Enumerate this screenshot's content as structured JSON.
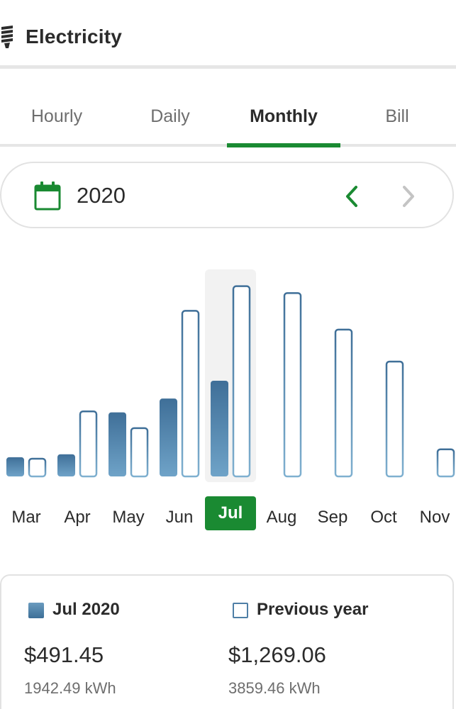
{
  "header": {
    "title": "Electricity",
    "icon": "lightbulb-icon"
  },
  "tabs": [
    {
      "label": "Hourly",
      "active": false
    },
    {
      "label": "Daily",
      "active": false
    },
    {
      "label": "Monthly",
      "active": true
    },
    {
      "label": "Bill",
      "active": false
    }
  ],
  "year_selector": {
    "year": "2020",
    "icon": "calendar-icon",
    "prev_icon": "chevron-left-icon",
    "next_icon": "chevron-right-icon"
  },
  "colors": {
    "accent": "#1a8a32",
    "bar_current": "#4a7aa3",
    "bar_previous_outline": "#4f7fa6",
    "divider": "#e6e6e6"
  },
  "chart_data": {
    "type": "bar",
    "unit": "kWh",
    "categories": [
      "Mar",
      "Apr",
      "May",
      "Jun",
      "Jul",
      "Aug",
      "Sep",
      "Oct",
      "Nov"
    ],
    "selected": "Jul",
    "series": [
      {
        "name": "Jul 2020",
        "values": [
          390,
          450,
          1300,
          1580,
          1942.49,
          null,
          null,
          null,
          null
        ]
      },
      {
        "name": "Previous year",
        "values": [
          360,
          1320,
          980,
          3360,
          3859.46,
          3720,
          2980,
          2330,
          550
        ]
      }
    ],
    "ylim": [
      0,
      4200
    ]
  },
  "summary": {
    "current": {
      "label": "Jul 2020",
      "amount": "$491.45",
      "kwh": "1942.49 kWh"
    },
    "previous": {
      "label": "Previous year",
      "amount": "$1,269.06",
      "kwh": "3859.46 kWh"
    }
  }
}
